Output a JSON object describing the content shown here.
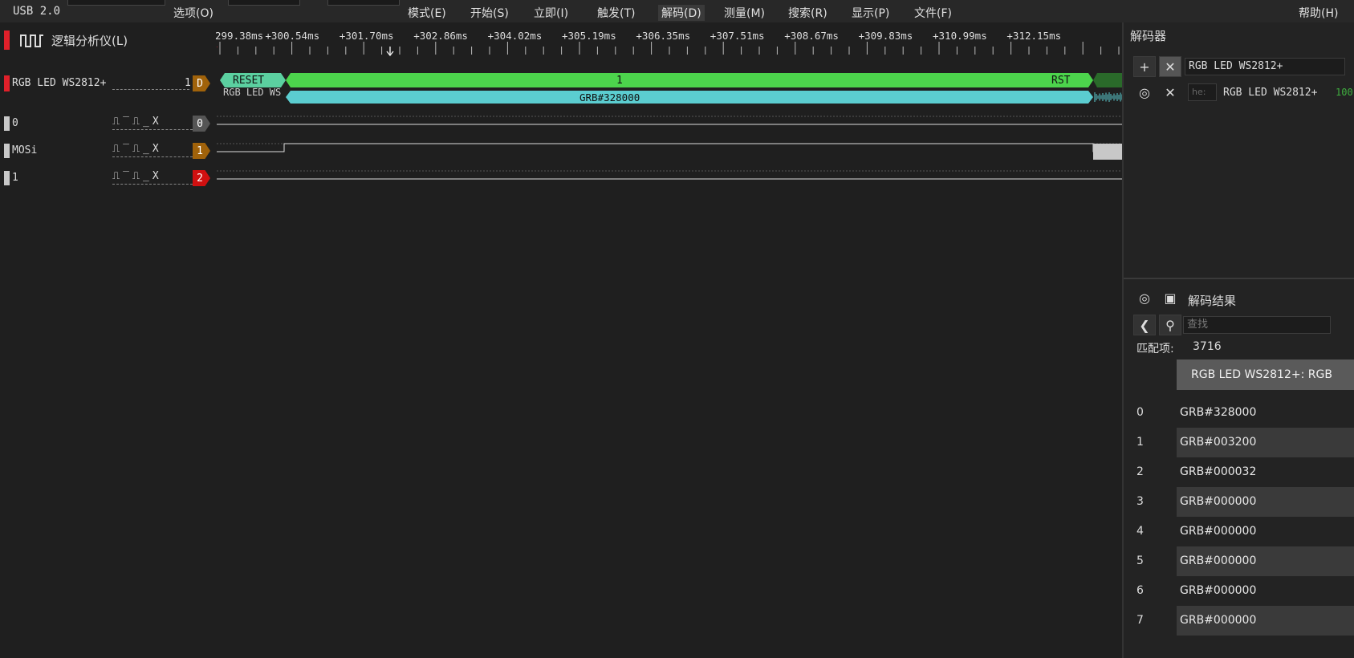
{
  "menu": {
    "usb": "USB 2.0",
    "options": "选项(O)",
    "mode": "模式(E)",
    "start": "开始(S)",
    "instant": "立即(I)",
    "trigger": "触发(T)",
    "decode": "解码(D)",
    "measure": "测量(M)",
    "search": "搜索(R)",
    "display": "显示(P)",
    "file": "文件(F)",
    "help": "帮助(H)"
  },
  "analyzer": {
    "title": "逻辑分析仪(L)"
  },
  "ruler": {
    "ticks": [
      "299.38ms",
      "+300.54ms",
      "+301.70ms",
      "+302.86ms",
      "+304.02ms",
      "+305.19ms",
      "+306.35ms",
      "+307.51ms",
      "+308.67ms",
      "+309.83ms",
      "+310.99ms",
      "+312.15ms"
    ]
  },
  "decoder_row": {
    "label": "RGB LED WS2812+",
    "index": "1",
    "tag": "D",
    "reset": "RESET",
    "bit": "1",
    "rst": "RST",
    "sub_label": "RGB LED WS",
    "grb": "GRB#328000"
  },
  "channels": [
    {
      "label": "0",
      "trig": "⎍‾⎍_X",
      "tag": "0"
    },
    {
      "label": "MOSi",
      "trig": "⎍‾⎍_X",
      "tag": "1"
    },
    {
      "label": "1",
      "trig": "⎍‾⎍_X",
      "tag": "2"
    }
  ],
  "colors": {
    "green": "#4cd44c",
    "cyan": "#5bcdd0",
    "darkgreen": "#2a6a2a",
    "tag_orange": "#a0620a",
    "tag_red": "#d01010",
    "tag_gray": "#555555"
  },
  "sidebar": {
    "title": "解码器",
    "decoder_name": "RGB LED WS2812+",
    "format": "he:",
    "decoder_name2": "RGB LED WS2812+",
    "pct": "100",
    "results_title": "解码结果",
    "search_placeholder": "查找",
    "match_label": "匹配项:",
    "match_count": "3716",
    "column_header": "RGB LED WS2812+: RGB",
    "rows": [
      {
        "idx": "0",
        "val": "GRB#328000"
      },
      {
        "idx": "1",
        "val": "GRB#003200"
      },
      {
        "idx": "2",
        "val": "GRB#000032"
      },
      {
        "idx": "3",
        "val": "GRB#000000"
      },
      {
        "idx": "4",
        "val": "GRB#000000"
      },
      {
        "idx": "5",
        "val": "GRB#000000"
      },
      {
        "idx": "6",
        "val": "GRB#000000"
      },
      {
        "idx": "7",
        "val": "GRB#000000"
      }
    ]
  }
}
